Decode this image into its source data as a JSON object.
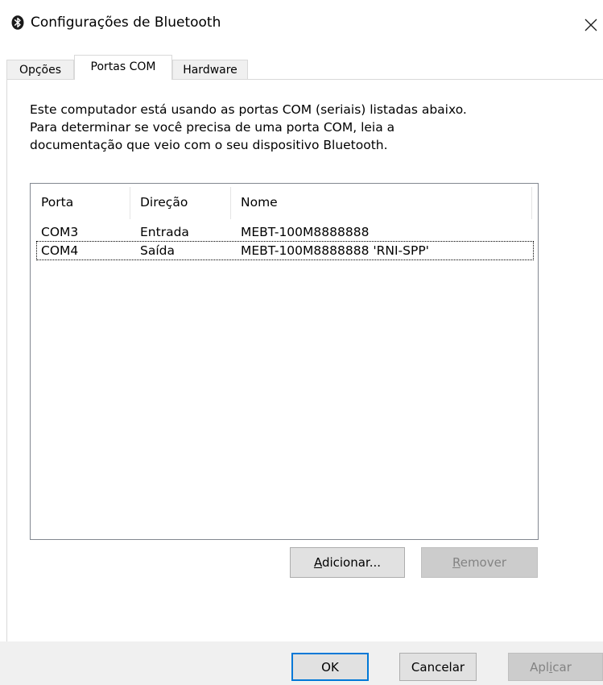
{
  "window": {
    "title": "Configurações de Bluetooth"
  },
  "tabs": [
    {
      "label": "Opções",
      "active": false
    },
    {
      "label": "Portas COM",
      "active": true
    },
    {
      "label": "Hardware",
      "active": false
    }
  ],
  "description": {
    "line1": "Este computador está usando as portas COM (seriais) listadas abaixo.",
    "line2": "Para determinar se você precisa de uma porta COM, leia a",
    "line3": "documentação que veio com o seu dispositivo Bluetooth."
  },
  "ports_table": {
    "columns": [
      "Porta",
      "Direção",
      "Nome"
    ],
    "rows": [
      {
        "port": "COM3",
        "direction": "Entrada",
        "name": "MEBT-100M8888888"
      },
      {
        "port": "COM4",
        "direction": "Saída",
        "name": "MEBT-100M8888888 'RNI-SPP'"
      }
    ],
    "focused_row": 1
  },
  "buttons": {
    "add": {
      "prefix": "",
      "mnemonic": "A",
      "rest": "dicionar...",
      "enabled": true
    },
    "remove": {
      "prefix": "",
      "mnemonic": "R",
      "rest": "emover",
      "enabled": false
    },
    "ok": {
      "label": "OK",
      "enabled": true,
      "default": true
    },
    "cancel": {
      "label": "Cancelar",
      "enabled": true
    },
    "apply": {
      "prefix": "Apl",
      "mnemonic": "i",
      "rest": "car",
      "enabled": false
    }
  },
  "icons": {
    "app": "bluetooth-icon",
    "close": "close-icon"
  },
  "colors": {
    "accent": "#0078d7",
    "bottom_bar": "#f0f0f0",
    "disabled_button": "#cccccc",
    "disabled_text": "#838383"
  }
}
